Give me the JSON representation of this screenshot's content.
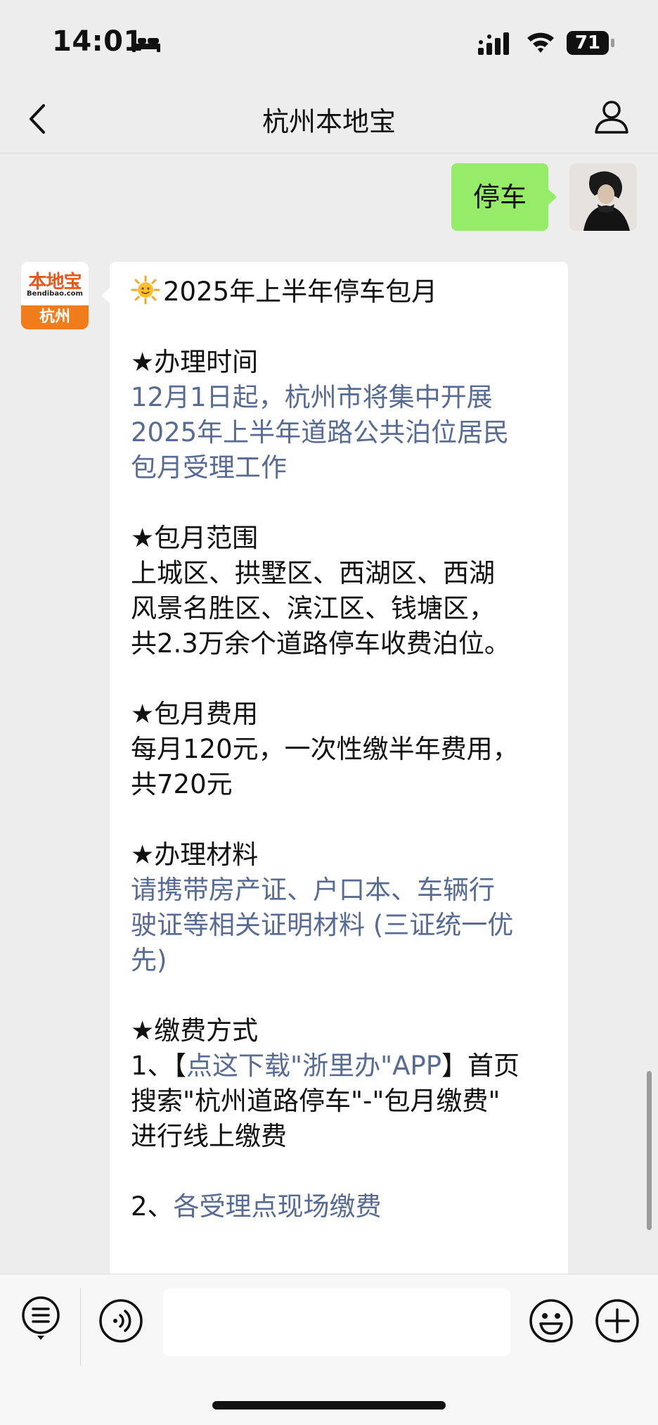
{
  "status_bar": {
    "time": "14:01",
    "battery": "71"
  },
  "nav": {
    "title": "杭州本地宝"
  },
  "sent_message": {
    "text": "停车"
  },
  "bot": {
    "logo_text": "本地宝",
    "logo_sub": "Bendibao.com",
    "logo_city": "杭州"
  },
  "received_message": {
    "title": "2025年上半年停车包月",
    "s1_heading": "★办理时间",
    "s1_lines": [
      "12月1日起，杭州市将集中开展",
      "2025年上半年道路公共泊位居民",
      "包月受理工作"
    ],
    "s2_heading": "★包月范围",
    "s2_lines": [
      "上城区、拱墅区、西湖区、西湖",
      "风景名胜区、滨江区、钱塘区，",
      "共2.3万余个道路停车收费泊位。"
    ],
    "s3_heading": "★包月费用",
    "s3_lines": [
      "每月120元，一次性缴半年费用，",
      "共720元"
    ],
    "s4_heading": "★办理材料",
    "s4_lines": [
      "请携带房产证、户口本、车辆行",
      "驶证等相关证明材料 (三证统一优",
      "先)"
    ],
    "s5_heading": "★缴费方式",
    "s5_item1_prefix": "1、【",
    "s5_item1_link": "点这下载\"浙里办\"APP",
    "s5_item1_suffix": "】首页",
    "s5_item1_lines": [
      "搜索\"杭州道路停车\"-\"包月缴费\"",
      "进行线上缴费"
    ],
    "s5_item2_prefix": "2、",
    "s5_item2_link": "各受理点现场缴费"
  },
  "icons": {
    "back": "chevron-left-icon",
    "profile": "person-icon",
    "menu": "list-menu-icon",
    "voice": "voice-icon",
    "emoji": "smiley-icon",
    "plus": "plus-icon"
  },
  "colors": {
    "sent_bubble": "#95ec69",
    "link": "#576b95",
    "brand_orange": "#f07c1c"
  }
}
